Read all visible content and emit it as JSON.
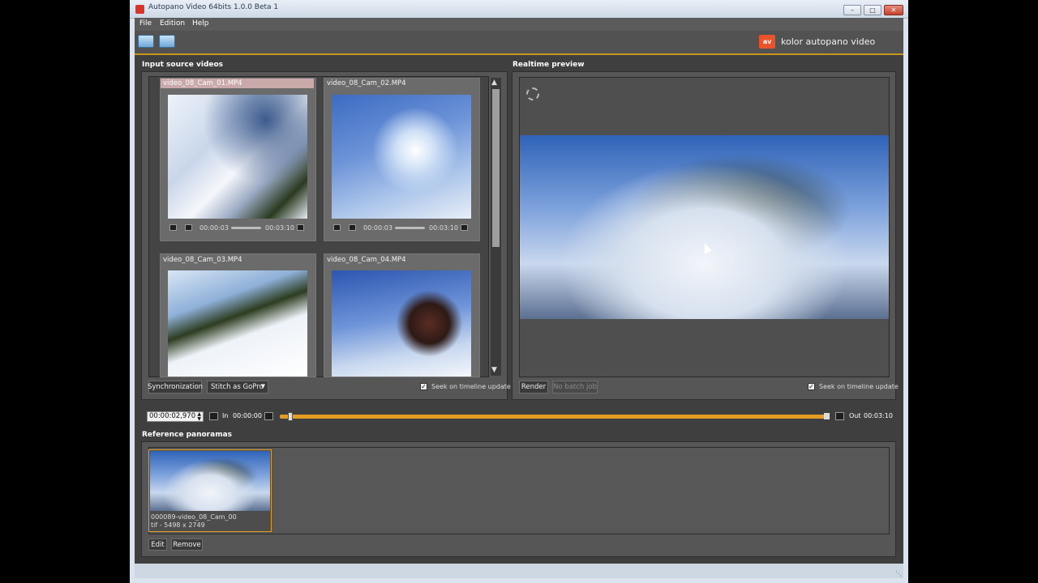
{
  "window": {
    "title": "Autopano Video 64bits 1.0.0 Beta 1"
  },
  "menu": {
    "items": [
      "File",
      "Edition",
      "Help"
    ]
  },
  "brand": {
    "name": "kolor autopano video",
    "mark": "av"
  },
  "input_panel": {
    "label": "Input source videos",
    "videos": [
      {
        "name": "video_08_Cam_01.MP4",
        "current": "00:00:03",
        "total": "00:03:10",
        "selected": true
      },
      {
        "name": "video_08_Cam_02.MP4",
        "current": "00:00:03",
        "total": "00:03:10",
        "selected": false
      },
      {
        "name": "video_08_Cam_03.MP4",
        "current": "",
        "total": "",
        "selected": false
      },
      {
        "name": "video_08_Cam_04.MP4",
        "current": "",
        "total": "",
        "selected": false
      }
    ],
    "sync_button": "Synchronization",
    "stitch_button": "Stitch as GoPro",
    "seek_label": "Seek on timeline update"
  },
  "preview_panel": {
    "label": "Realtime preview",
    "render_button": "Render",
    "batch_button": "No batch job",
    "seek_label": "Seek on timeline update"
  },
  "timeline": {
    "timecode": "00:00:02,970",
    "in_label": "In",
    "in_time": "00:00:00",
    "out_label": "Out",
    "out_time": "00:03:10",
    "position": 0.015
  },
  "reference_panel": {
    "label": "Reference panoramas",
    "item": {
      "name": "000089-video_08_Cam_00",
      "info": "tif - 5498 x 2749"
    },
    "edit_button": "Edit",
    "remove_button": "Remove"
  },
  "colors": {
    "accent": "#e39d22",
    "panel": "#565656",
    "background": "#3f3f3f"
  }
}
